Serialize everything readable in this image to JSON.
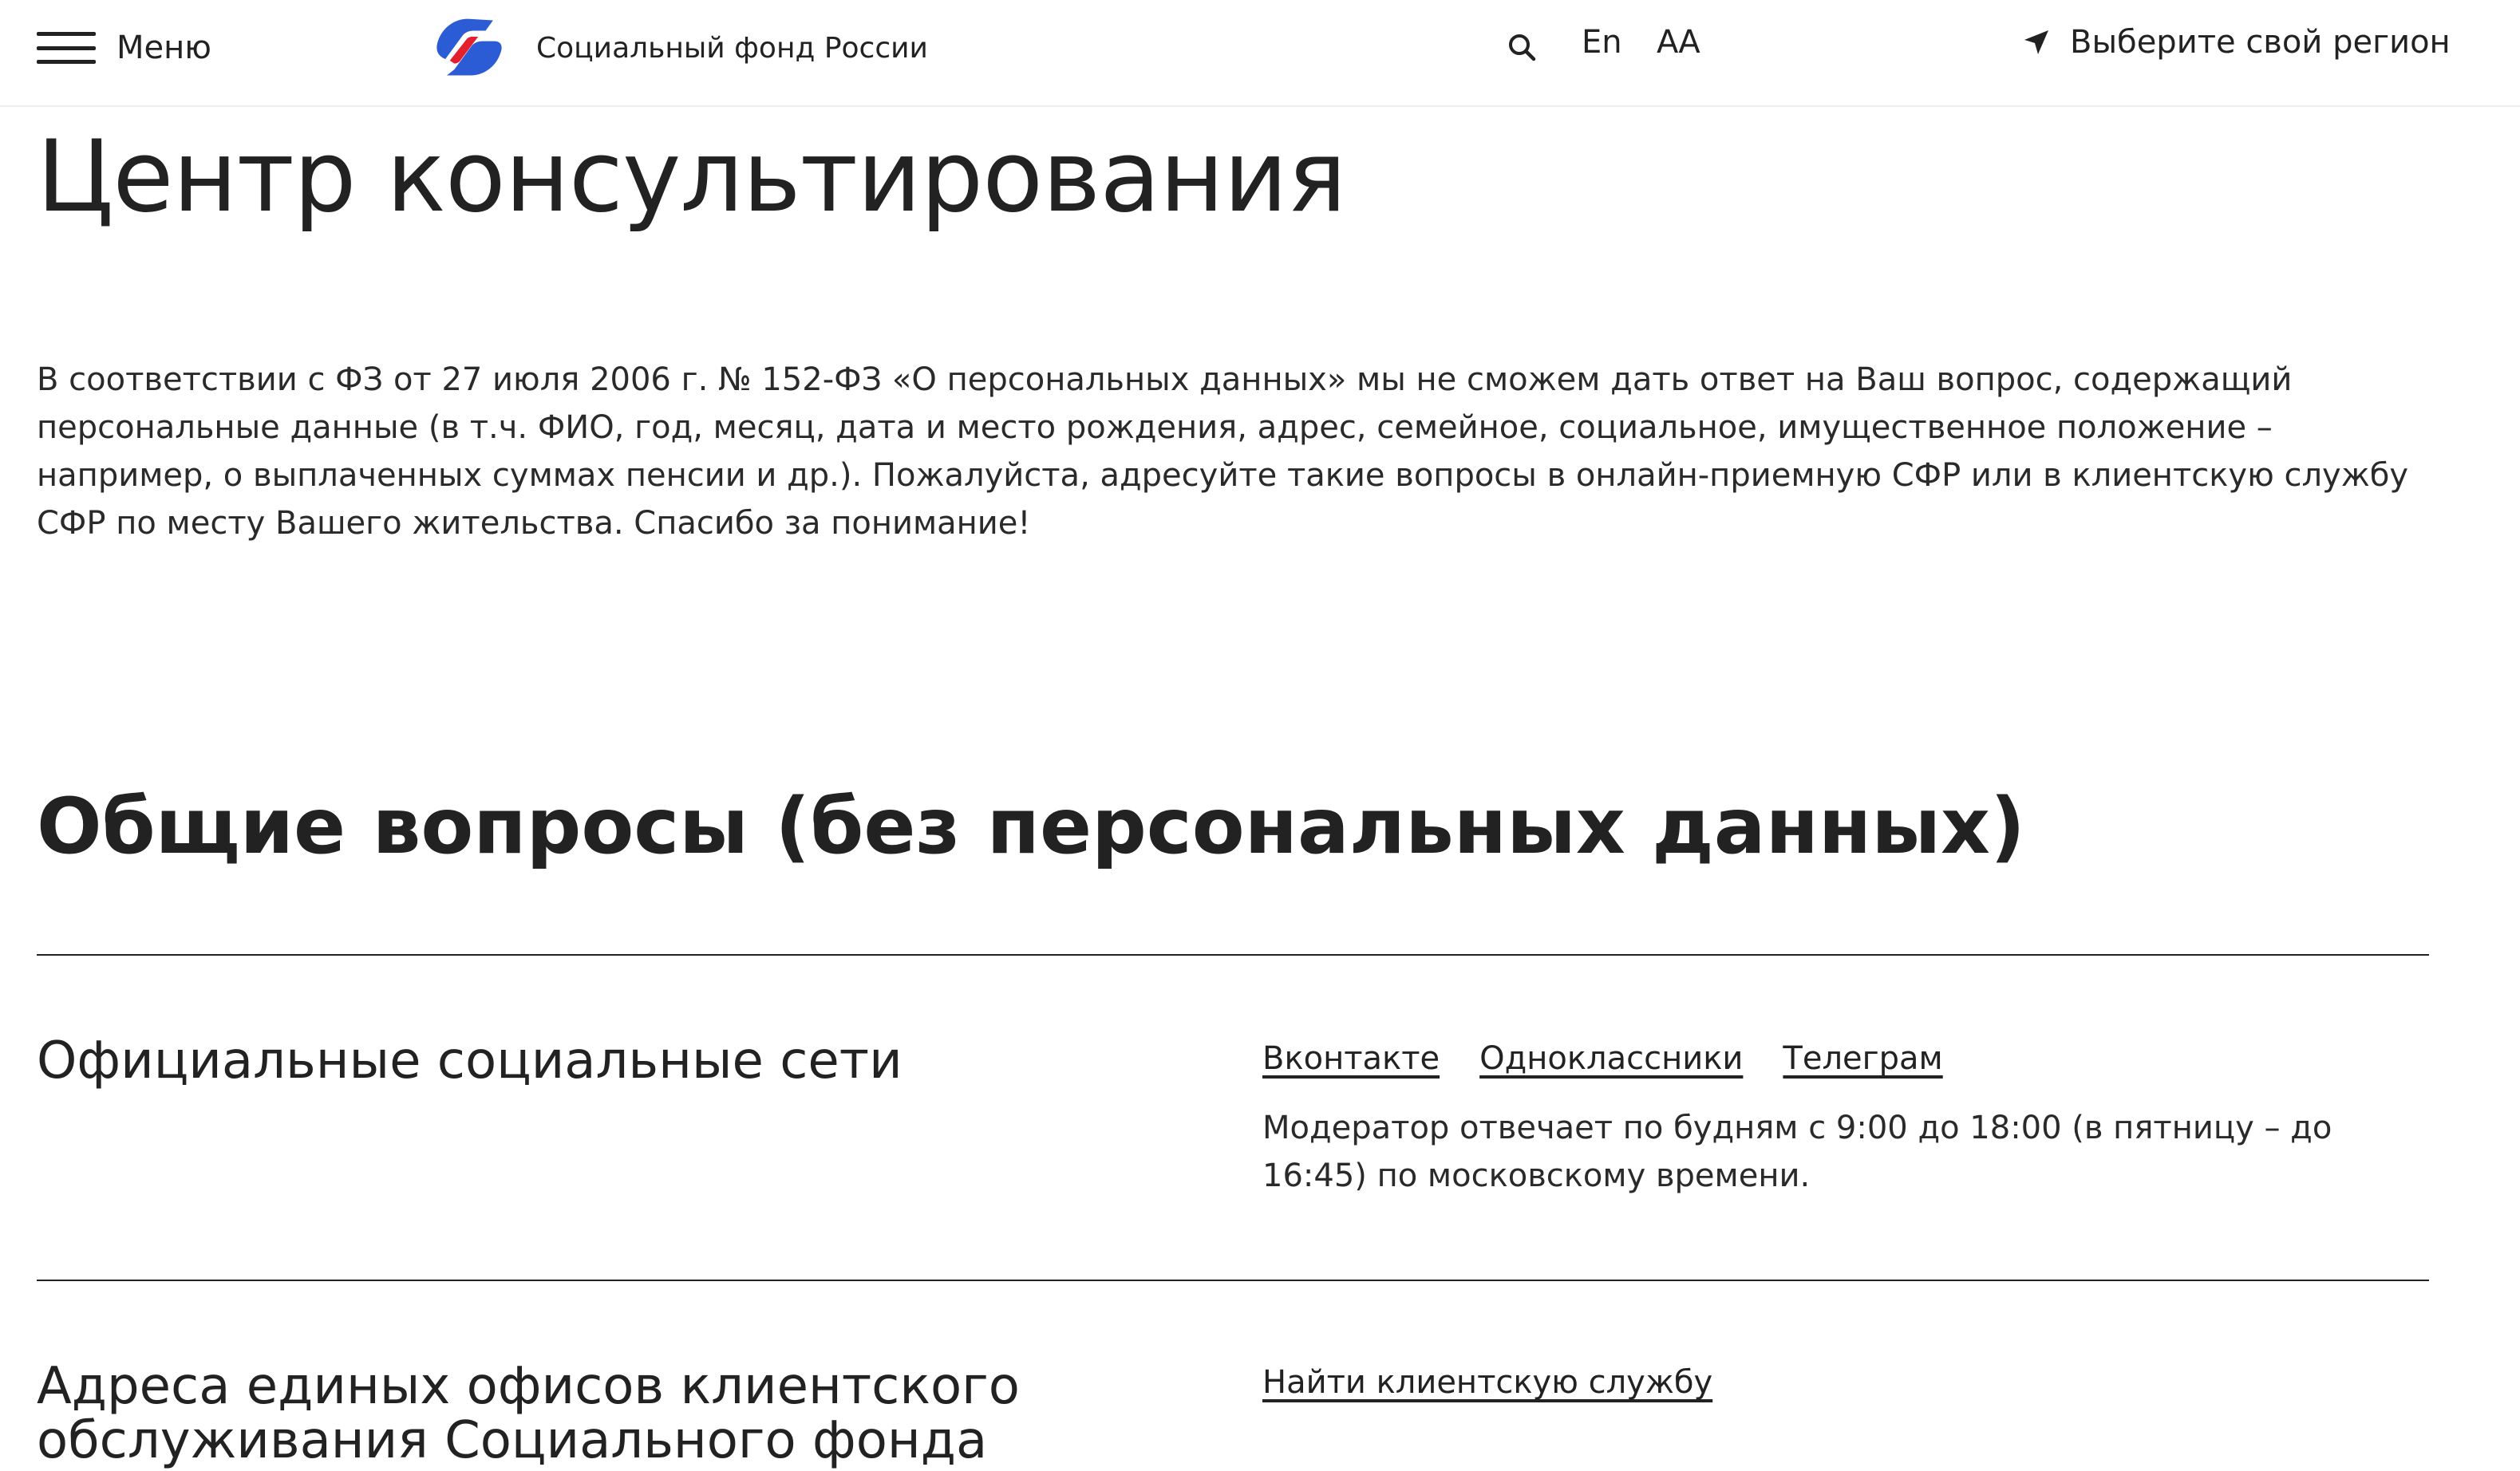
{
  "header": {
    "menu_label": "Меню",
    "brand_name": "Социальный фонд России",
    "lang_label": "En",
    "font_size_label": "АА",
    "region_label": "Выберите свой регион",
    "icons": {
      "menu": "hamburger-icon",
      "logo": "sfr-logo-icon",
      "search": "search-icon",
      "region": "location-arrow-icon"
    },
    "colors": {
      "logo_blue": "#2b5cd6",
      "logo_red": "#e4202c"
    }
  },
  "main": {
    "title": "Центр консультирования",
    "notice": "В соответствии с ФЗ от 27 июля 2006 г. № 152-ФЗ «О персональных данных» мы не сможем дать ответ на Ваш вопрос, содержащий персональные данные (в т.ч. ФИО, год, месяц, дата и место рождения, адрес, семейное, социальное, имущественное положение – например, о выплаченных суммах пенсии и др.). Пожалуйста, адресуйте такие вопросы в онлайн-приемную СФР или в клиентскую службу СФР по месту Вашего жительства. Спасибо за понимание!",
    "section_title": "Общие вопросы (без персональных данных)",
    "rows": [
      {
        "title": "Официальные социальные сети",
        "links": [
          "Вконтакте",
          "Одноклассники",
          "Телеграм"
        ],
        "text": "Модератор отвечает по будням с 9:00 до 18:00 (в пятницу – до 16:45) по московскому времени."
      },
      {
        "title": "Адреса единых офисов клиентского обслуживания Социального фонда",
        "links": [
          "Найти клиентскую службу"
        ]
      }
    ]
  }
}
